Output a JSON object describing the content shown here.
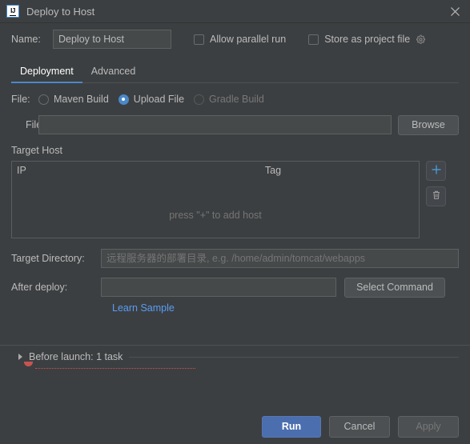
{
  "window": {
    "title": "Deploy to Host",
    "app_icon": "intellij-idea-icon",
    "close_icon": "close-icon"
  },
  "name_row": {
    "label": "Name:",
    "value": "Deploy to Host",
    "allow_parallel_run": {
      "label": "Allow parallel run",
      "checked": false
    },
    "store_as_project_file": {
      "label": "Store as project file",
      "checked": false
    },
    "gear_icon": "gear-icon"
  },
  "tabs": [
    {
      "label": "Deployment",
      "active": true
    },
    {
      "label": "Advanced",
      "active": false
    }
  ],
  "file_source": {
    "label": "File:",
    "options": [
      {
        "label": "Maven Build",
        "selected": false,
        "disabled": false
      },
      {
        "label": "Upload File",
        "selected": true,
        "disabled": false
      },
      {
        "label": "Gradle Build",
        "selected": false,
        "disabled": true
      }
    ]
  },
  "file_field": {
    "label": "File:",
    "value": "",
    "placeholder": "",
    "browse_label": "Browse"
  },
  "target_host": {
    "section_label": "Target Host",
    "columns": [
      "IP",
      "Tag"
    ],
    "rows": [],
    "empty_text": "press \"+\" to add host",
    "add_icon": "plus-icon",
    "delete_icon": "trash-icon"
  },
  "target_directory": {
    "label": "Target Directory:",
    "value": "",
    "placeholder": "远程服务器的部署目录, e.g. /home/admin/tomcat/webapps"
  },
  "after_deploy": {
    "label": "After deploy:",
    "value": "",
    "placeholder": "",
    "select_command_label": "Select Command",
    "link_label": "Learn Sample"
  },
  "before_launch": {
    "label": "Before launch: 1 task",
    "expand_icon": "triangle-right-icon"
  },
  "footer": {
    "run_label": "Run",
    "cancel_label": "Cancel",
    "apply_label": "Apply"
  },
  "colors": {
    "background": "#3c3f41",
    "accent": "#4a88c7",
    "link": "#589df6",
    "primary_button": "#4b6eaf",
    "field_background": "#45494a",
    "text": "#bbbbbb",
    "muted_text": "#777777",
    "error": "#c75450"
  }
}
